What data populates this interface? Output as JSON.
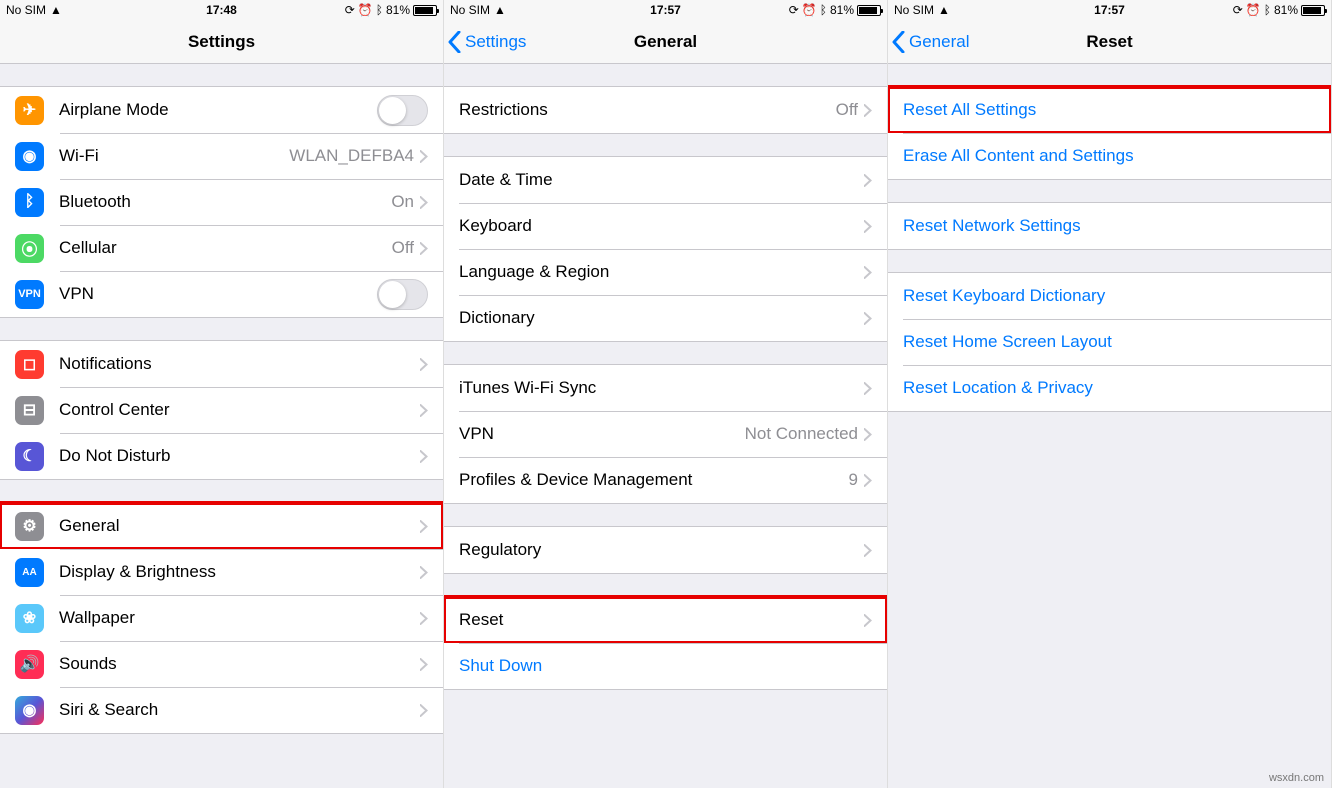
{
  "status": {
    "carrier": "No SIM",
    "wifi": "✓",
    "battery_pct": "81%"
  },
  "screen1": {
    "time": "17:48",
    "title": "Settings",
    "rows": {
      "airplane": "Airplane Mode",
      "wifi": "Wi-Fi",
      "wifi_val": "WLAN_DEFBA4",
      "bt": "Bluetooth",
      "bt_val": "On",
      "cell": "Cellular",
      "cell_val": "Off",
      "vpn": "VPN",
      "notif": "Notifications",
      "cc": "Control Center",
      "dnd": "Do Not Disturb",
      "general": "General",
      "display": "Display & Brightness",
      "wallpaper": "Wallpaper",
      "sounds": "Sounds",
      "siri": "Siri & Search"
    }
  },
  "screen2": {
    "time": "17:57",
    "back": "Settings",
    "title": "General",
    "rows": {
      "restrictions": "Restrictions",
      "restrictions_val": "Off",
      "date": "Date & Time",
      "keyboard": "Keyboard",
      "lang": "Language & Region",
      "dict": "Dictionary",
      "itunes": "iTunes Wi-Fi Sync",
      "vpn": "VPN",
      "vpn_val": "Not Connected",
      "profiles": "Profiles & Device Management",
      "profiles_val": "9",
      "regulatory": "Regulatory",
      "reset": "Reset",
      "shutdown": "Shut Down"
    }
  },
  "screen3": {
    "time": "17:57",
    "back": "General",
    "title": "Reset",
    "rows": {
      "reset_all": "Reset All Settings",
      "erase": "Erase All Content and Settings",
      "net": "Reset Network Settings",
      "keyb": "Reset Keyboard Dictionary",
      "home": "Reset Home Screen Layout",
      "loc": "Reset Location & Privacy"
    }
  },
  "source": "wsxdn.com"
}
